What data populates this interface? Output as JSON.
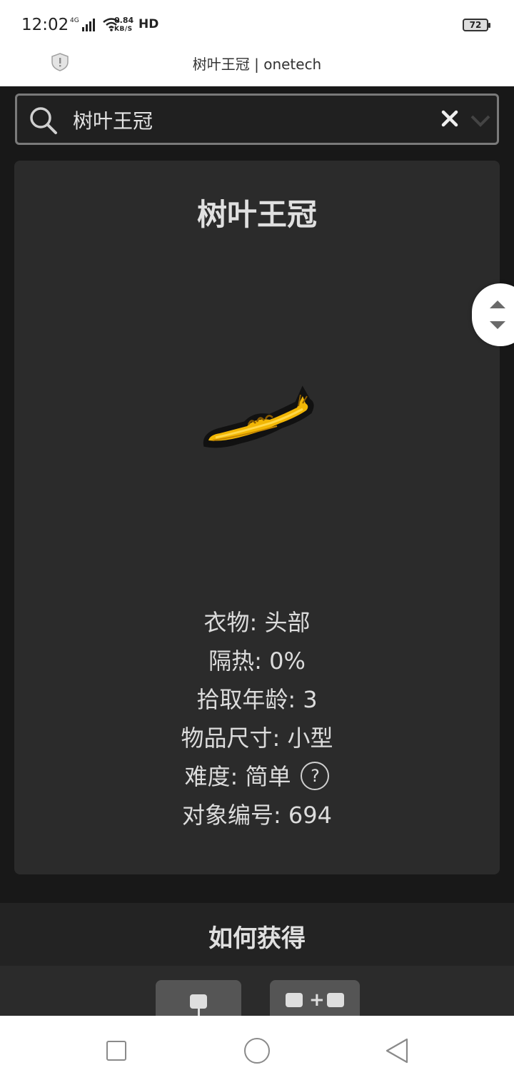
{
  "status_bar": {
    "time": "12:02",
    "network_label": "4G",
    "speed_value": "0.84",
    "speed_unit": "KB/S",
    "hd_label": "HD",
    "battery_level": "72"
  },
  "browser": {
    "page_title": "树叶王冠 | onetech",
    "security_icon": "shield-icon"
  },
  "search": {
    "value": "树叶王冠",
    "icons": [
      "search-icon",
      "clear-icon",
      "chevron-down-icon"
    ]
  },
  "item": {
    "title": "树叶王冠",
    "image": "leaf-crown-image",
    "properties": [
      "衣物: 头部",
      "隔热: 0%",
      "拾取年龄: 3",
      "物品尺寸: 小型",
      "难度: 简单",
      "对象编号: 694"
    ],
    "help_label": "?"
  },
  "section": {
    "title": "如何获得",
    "plus_label": "+"
  },
  "colors": {
    "background": "#181818",
    "card": "#2b2b2b",
    "text": "#dcdcdc",
    "crown_gold": "#f2b705"
  }
}
